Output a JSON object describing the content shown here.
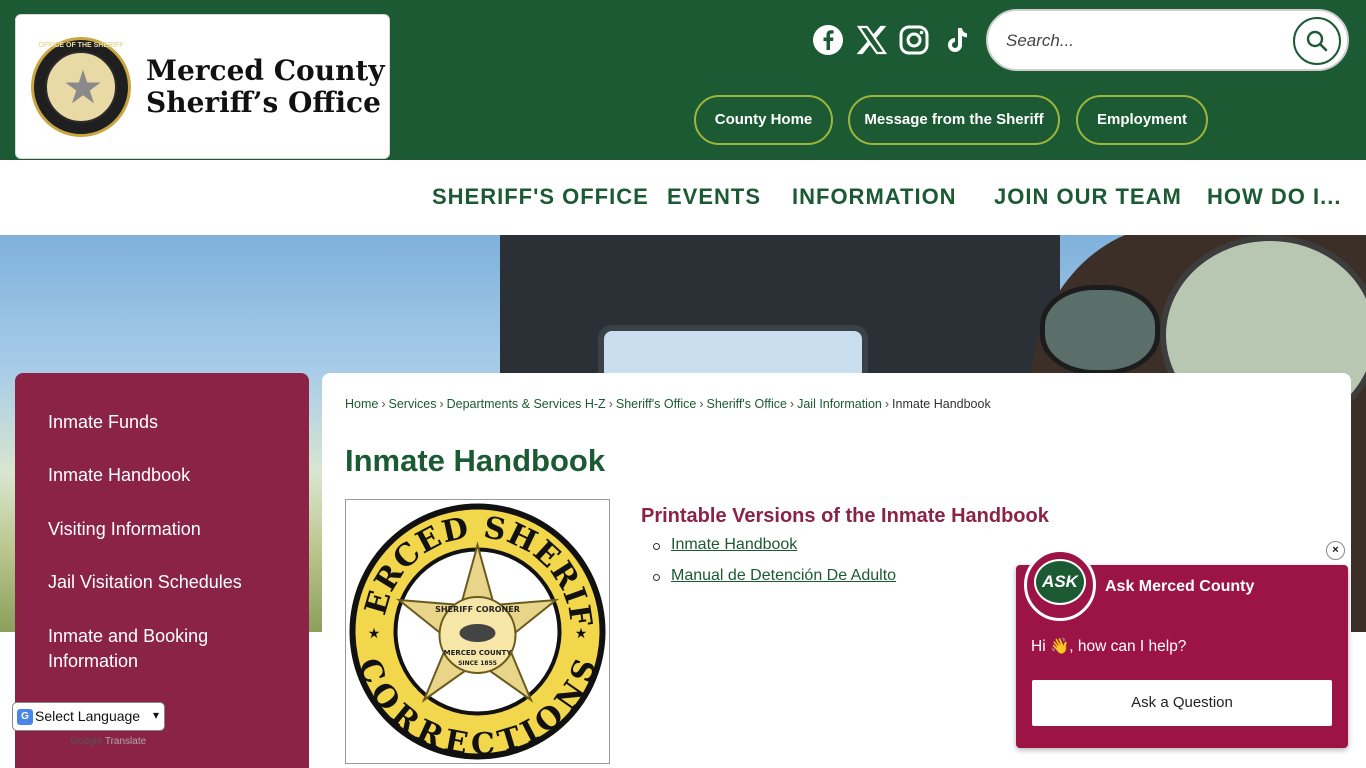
{
  "header": {
    "logo_line1": "Merced County",
    "logo_line2": "Sheriff’s Office",
    "seal_text": "OFFICE OF THE SHERIFF",
    "seal_bottom": "MERCED COUNTY",
    "social": [
      "facebook-icon",
      "x-icon",
      "instagram-icon",
      "tiktok-icon"
    ],
    "search_placeholder": "Search...",
    "quick_links": [
      "County Home",
      "Message from the Sheriff",
      "Employment"
    ]
  },
  "nav": {
    "items": [
      "SHERIFF'S OFFICE",
      "EVENTS",
      "INFORMATION",
      "JOIN OUR TEAM",
      "HOW DO I..."
    ]
  },
  "sidebar": {
    "items": [
      "Inmate Funds",
      "Inmate Handbook",
      "Visiting Information",
      "Jail Visitation Schedules",
      "Inmate and Booking Information"
    ]
  },
  "language": {
    "selected": "Select Language",
    "powered_by": "Google",
    "powered_suffix": "Translate"
  },
  "breadcrumb": {
    "items": [
      "Home",
      "Services",
      "Departments & Services H-Z",
      "Sheriff's Office",
      "Sheriff's Office",
      "Jail Information"
    ],
    "current": "Inmate Handbook"
  },
  "main": {
    "title": "Inmate Handbook",
    "badge_top": "MERCED SHERIFF",
    "badge_bottom": "CORRECTIONS",
    "badge_center_top": "SHERIFF CORONER",
    "badge_center_mid": "MERCED COUNTY",
    "badge_center_bot": "SINCE 1855",
    "section_title": "Printable Versions of the Inmate Handbook",
    "documents": [
      "Inmate Handbook",
      "Manual de Detención De Adulto"
    ]
  },
  "chat": {
    "avatar_text": "ASK",
    "title": "Ask Merced County",
    "greeting": "Hi 👋, how can I help?",
    "button": "Ask a Question",
    "close": "×"
  },
  "colors": {
    "brand_green": "#1c5a34",
    "accent_maroon": "#8a2346",
    "chat_maroon": "#9c1446",
    "pill_border": "#9cb53a"
  }
}
